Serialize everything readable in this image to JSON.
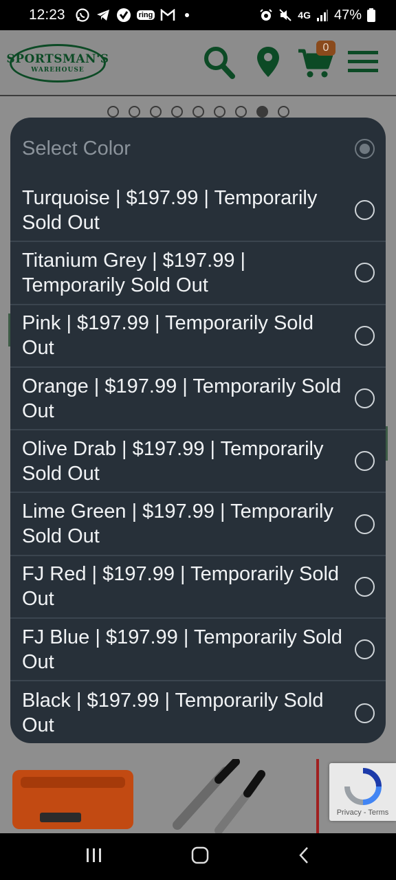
{
  "status_bar": {
    "time": "12:23",
    "left_icons": [
      "whatsapp-icon",
      "telegram-icon",
      "verified-icon",
      "ring-icon",
      "gmail-icon"
    ],
    "ring_label": "ring",
    "network": "4G",
    "battery": "47%"
  },
  "header": {
    "logo_top": "SPORTSMAN'S",
    "logo_bottom": "WAREHOUSE",
    "cart_count": "0",
    "brand_color": "#0c4a25"
  },
  "carousel": {
    "dot_count": 9,
    "active_index": 7
  },
  "modal": {
    "title": "Select Color",
    "options": [
      {
        "label": "Turquoise | $197.99 | Temporarily Sold Out"
      },
      {
        "label": "Titanium Grey | $197.99 | Temporarily Sold Out"
      },
      {
        "label": "Pink | $197.99 | Temporarily Sold Out"
      },
      {
        "label": "Orange | $197.99 | Temporarily Sold Out"
      },
      {
        "label": "Olive Drab | $197.99 | Temporarily Sold Out"
      },
      {
        "label": "Lime Green | $197.99 | Temporarily Sold Out"
      },
      {
        "label": "FJ Red | $197.99 | Temporarily Sold Out"
      },
      {
        "label": "FJ Blue | $197.99 | Temporarily Sold Out"
      },
      {
        "label": "Black | $197.99 | Temporarily Sold Out"
      }
    ]
  },
  "recaptcha": {
    "text": "Privacy - Terms"
  },
  "colors": {
    "modal_bg": "#273039",
    "option_text": "#f1f3f5",
    "title_text": "#8b939b"
  }
}
